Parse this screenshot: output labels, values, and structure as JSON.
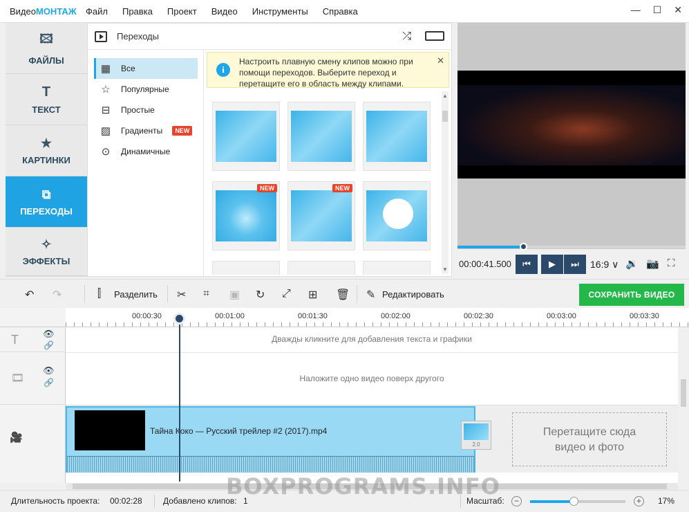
{
  "app": {
    "logo_part1": "Видео",
    "logo_part2": "МОНТАЖ"
  },
  "menu": [
    "Файл",
    "Правка",
    "Проект",
    "Видео",
    "Инструменты",
    "Справка"
  ],
  "window_controls": [
    "minimize-icon",
    "maximize-icon",
    "close-icon"
  ],
  "nav": [
    {
      "label": "ФАЙЛЫ",
      "icon": "image-icon",
      "active": false
    },
    {
      "label": "ТЕКСТ",
      "icon": "text-icon",
      "active": false
    },
    {
      "label": "КАРТИНКИ",
      "icon": "star-icon",
      "active": false
    },
    {
      "label": "ПЕРЕХОДЫ",
      "icon": "transitions-icon",
      "active": true
    },
    {
      "label": "ЭФФЕКТЫ",
      "icon": "magic-wand-icon",
      "active": false
    }
  ],
  "panel": {
    "title": "Переходы",
    "categories": [
      {
        "label": "Все",
        "active": true
      },
      {
        "label": "Популярные",
        "active": false
      },
      {
        "label": "Простые",
        "active": false
      },
      {
        "label": "Градиенты",
        "active": false,
        "badge": "NEW"
      },
      {
        "label": "Динамичные",
        "active": false
      }
    ],
    "tip": "Настроить плавную смену клипов можно при помощи переходов. Выберите переход и перетащите его в область между клипами.",
    "thumb_badge": "NEW"
  },
  "preview": {
    "time": "00:00:41.500",
    "ratio": "16:9 ∨",
    "progress": 0.285
  },
  "toolbar": {
    "split_label": "Разделить",
    "edit_label": "Редактировать",
    "save_label": "СОХРАНИТЬ ВИДЕО"
  },
  "timeline": {
    "ticks": [
      "00:00:30",
      "00:01:00",
      "00:01:30",
      "00:02:00",
      "00:02:30",
      "00:03:00",
      "00:03:30"
    ],
    "text_hint": "Дважды кликните для добавления текста и графики",
    "overlay_hint": "Наложите одно видео поверх другого",
    "clip_title": "Тайна Коко — Русский трейлер #2 (2017).mp4",
    "transition_value": "2.0",
    "drop_line1": "Перетащите сюда",
    "drop_line2": "видео и фото"
  },
  "status": {
    "duration_label": "Длительность проекта:",
    "duration_value": "00:02:28",
    "clips_label": "Добавлено клипов:",
    "clips_value": "1",
    "zoom_label": "Масштаб:",
    "zoom_value": "17%"
  },
  "watermark": "BOXPROGRAMS.INFO",
  "colors": {
    "accent": "#1ea6e8",
    "save": "#24b84a",
    "badge": "#e8442b",
    "dark": "#2b4a6b"
  }
}
